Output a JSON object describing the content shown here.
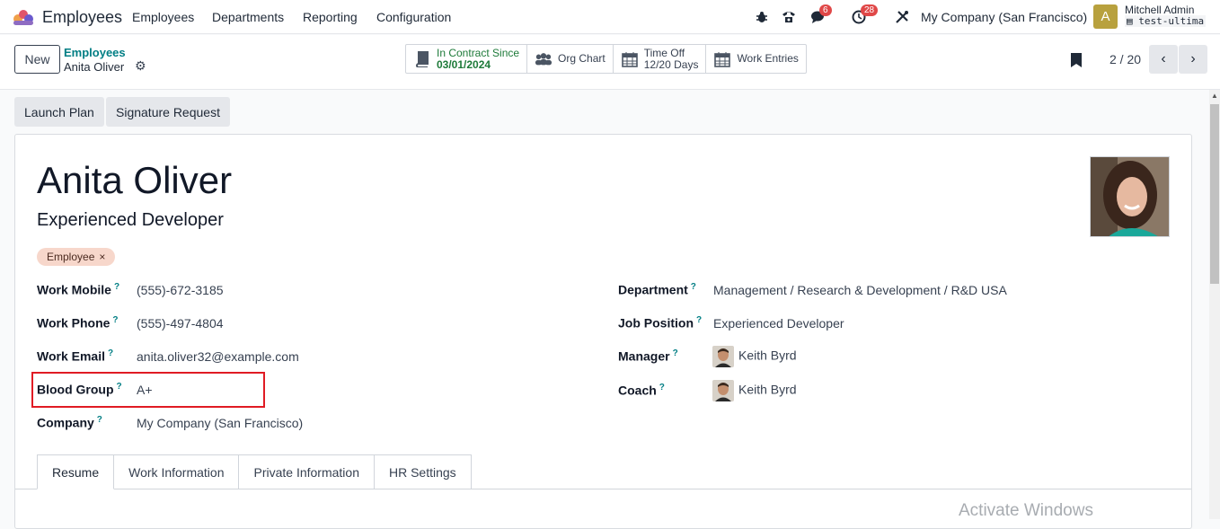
{
  "navbar": {
    "app_title": "Employees",
    "menu": [
      "Employees",
      "Departments",
      "Reporting",
      "Configuration"
    ],
    "messages_badge": "6",
    "activities_badge": "28",
    "company": "My Company (San Francisco)",
    "user_initial": "A",
    "user_name": "Mitchell Admin",
    "db_name": "test-ultima"
  },
  "control": {
    "new_label": "New",
    "breadcrumb_parent": "Employees",
    "breadcrumb_current": "Anita Oliver",
    "smart_buttons": {
      "contract_label": "In Contract Since",
      "contract_value": "03/01/2024",
      "org_chart": "Org Chart",
      "time_off_label": "Time Off",
      "time_off_value": "12/20 Days",
      "work_entries": "Work Entries"
    },
    "pager": "2 / 20"
  },
  "actions": {
    "launch_plan": "Launch Plan",
    "signature_request": "Signature Request"
  },
  "employee": {
    "name": "Anita Oliver",
    "job_title": "Experienced Developer",
    "tag": "Employee",
    "left_fields": [
      {
        "label": "Work Mobile",
        "value": "(555)-672-3185"
      },
      {
        "label": "Work Phone",
        "value": "(555)-497-4804"
      },
      {
        "label": "Work Email",
        "value": "anita.oliver32@example.com"
      },
      {
        "label": "Blood Group",
        "value": "A+"
      },
      {
        "label": "Company",
        "value": "My Company (San Francisco)"
      }
    ],
    "right_fields": [
      {
        "label": "Department",
        "value": "Management / Research & Development / R&D USA"
      },
      {
        "label": "Job Position",
        "value": "Experienced Developer"
      },
      {
        "label": "Manager",
        "value": "Keith Byrd"
      },
      {
        "label": "Coach",
        "value": "Keith Byrd"
      }
    ],
    "help_mark": "?"
  },
  "tabs": [
    "Resume",
    "Work Information",
    "Private Information",
    "HR Settings"
  ],
  "watermark": "Activate Windows",
  "colors": {
    "accent": "#017e84",
    "green": "#1d7a39",
    "badge_red": "#e04848",
    "highlight": "#e01b24",
    "tag_bg": "#f7d7cb"
  }
}
